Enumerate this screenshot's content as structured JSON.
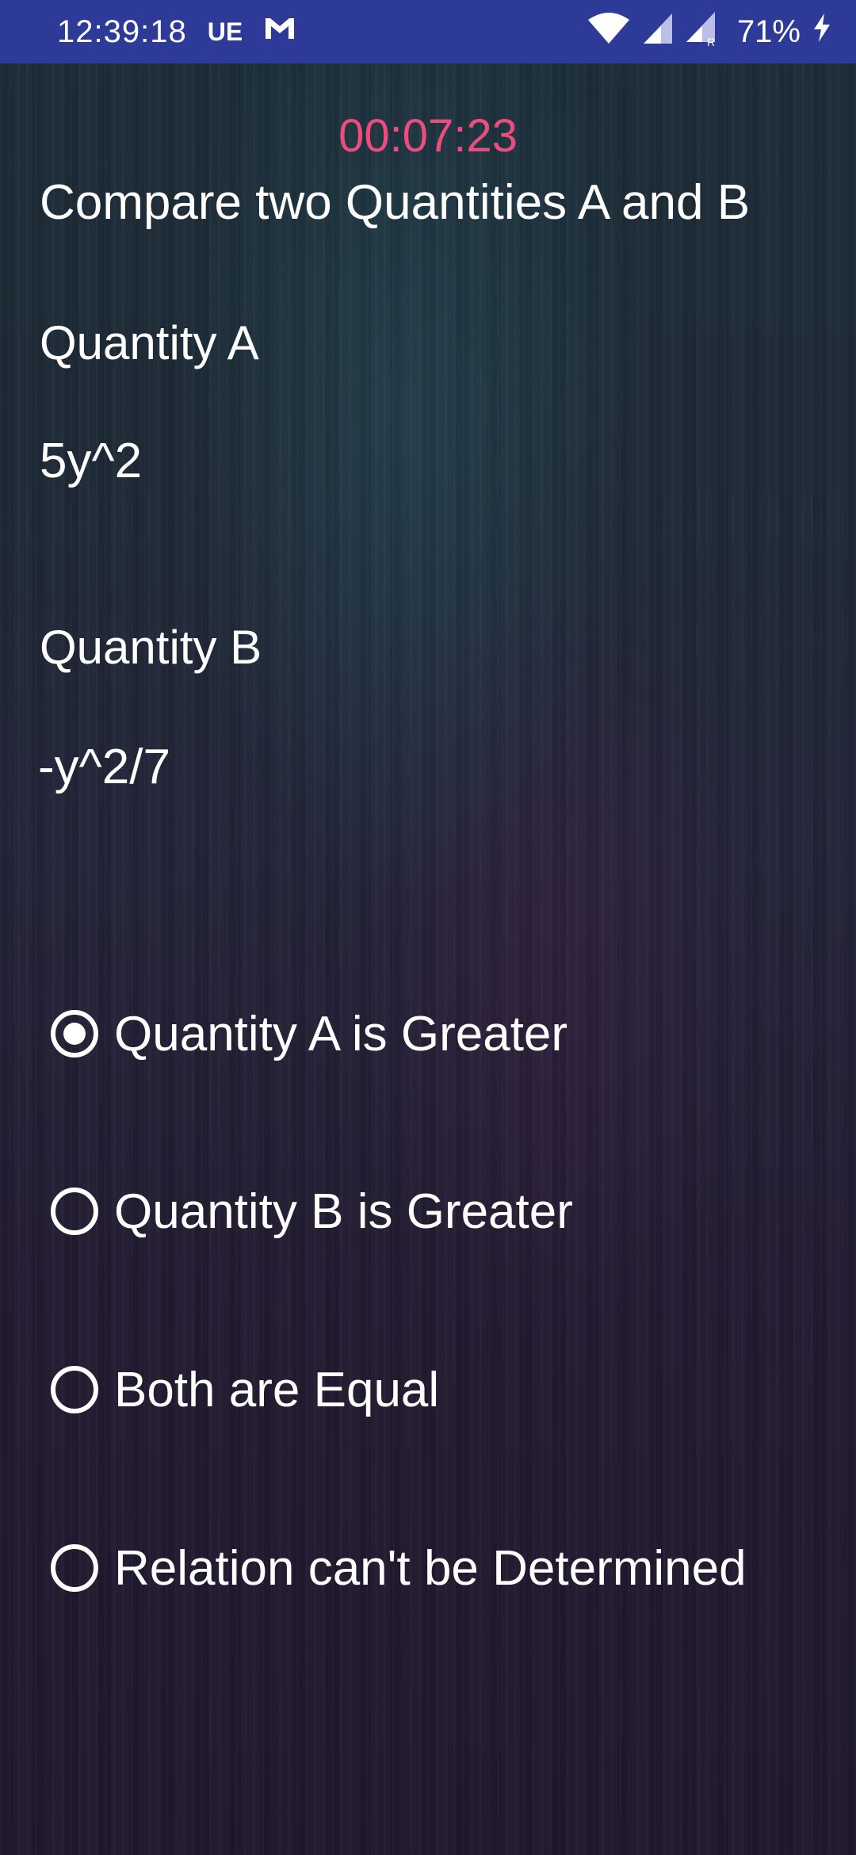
{
  "status_bar": {
    "time": "12:39:18",
    "carrier_badge": "UE",
    "battery_percent": "71%",
    "icons": [
      "gmail-icon",
      "wifi-icon",
      "signal-icon",
      "signal-roaming-icon",
      "charging-icon"
    ]
  },
  "timer": "00:07:23",
  "question": {
    "title": "Compare two Quantities A and B",
    "quantity_a_label": "Quantity A",
    "quantity_a_value": "5y^2",
    "quantity_b_label": "Quantity B",
    "quantity_b_value": "-y^2/7"
  },
  "options": [
    {
      "label": "Quantity A is Greater",
      "selected": true
    },
    {
      "label": "Quantity B is Greater",
      "selected": false
    },
    {
      "label": "Both are Equal",
      "selected": false
    },
    {
      "label": "Relation can't be Determined",
      "selected": false
    }
  ],
  "colors": {
    "status_bar": "#2d3a97",
    "timer": "#ee4c7e",
    "text": "#ffffff"
  }
}
